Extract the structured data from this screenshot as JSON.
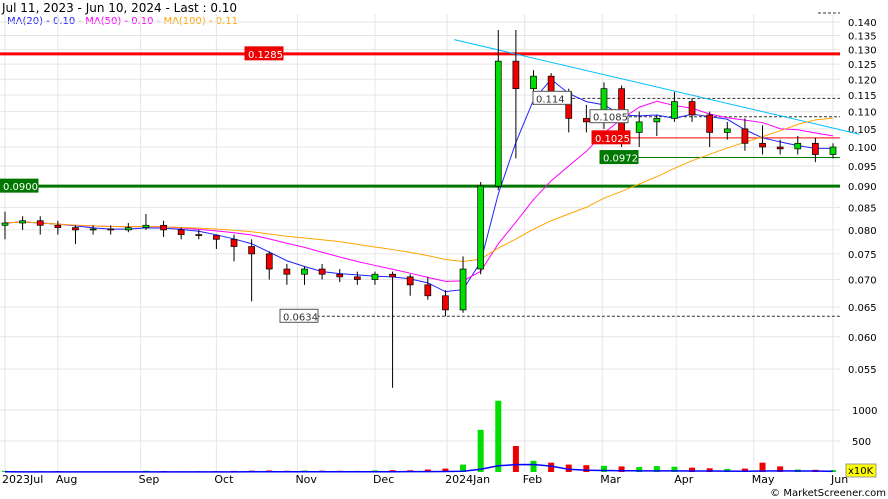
{
  "header": {
    "title": "Jul 11, 2023 - Jun 10, 2024 - Last : 0.10",
    "legend": [
      {
        "name": "MA(20)",
        "value": "0.10",
        "color": "#2020ff"
      },
      {
        "name": "MA(50)",
        "value": "0.10",
        "color": "#ff00ff"
      },
      {
        "name": "MA(100)",
        "value": "0.11",
        "color": "#ffa500"
      }
    ]
  },
  "chart_data": {
    "type": "candlestick",
    "title": "Jul 11, 2023 - Jun 10, 2024 - Last : 0.10",
    "y_ticks": [
      "0.140",
      "0.135",
      "0.130",
      "0.125",
      "0.120",
      "0.115",
      "0.110",
      "0.105",
      "0.100",
      "0.095",
      "0.090",
      "0.085",
      "0.080",
      "0.075",
      "0.070",
      "0.065",
      "0.060",
      "0.055"
    ],
    "ylim": [
      0.052,
      0.142
    ],
    "y_scale": "log",
    "volume_ticks": [
      "1000",
      "500"
    ],
    "volume_unit": "x10K",
    "months": [
      {
        "label": "2023Jul",
        "week": 0
      },
      {
        "label": "Aug",
        "week": 3
      },
      {
        "label": "Sep",
        "week": 7.7
      },
      {
        "label": "Oct",
        "week": 12
      },
      {
        "label": "Nov",
        "week": 16.6
      },
      {
        "label": "Dec",
        "week": 21
      },
      {
        "label": "2024Jan",
        "week": 25.1
      },
      {
        "label": "Feb",
        "week": 29.5
      },
      {
        "label": "Mar",
        "week": 33.9
      },
      {
        "label": "Apr",
        "week": 38.1
      },
      {
        "label": "May",
        "week": 42.5
      },
      {
        "label": "Jun",
        "week": 47
      }
    ],
    "candles": [
      [
        0.081,
        0.084,
        0.078,
        0.0815
      ],
      [
        0.0815,
        0.083,
        0.08,
        0.082
      ],
      [
        0.082,
        0.083,
        0.079,
        0.081
      ],
      [
        0.081,
        0.082,
        0.079,
        0.0805
      ],
      [
        0.0805,
        0.081,
        0.077,
        0.08
      ],
      [
        0.08,
        0.081,
        0.079,
        0.0802
      ],
      [
        0.0802,
        0.081,
        0.079,
        0.08
      ],
      [
        0.08,
        0.0815,
        0.0795,
        0.0805
      ],
      [
        0.0805,
        0.0835,
        0.08,
        0.081
      ],
      [
        0.081,
        0.082,
        0.0785,
        0.08
      ],
      [
        0.08,
        0.0805,
        0.078,
        0.079
      ],
      [
        0.079,
        0.08,
        0.078,
        0.0788
      ],
      [
        0.0788,
        0.079,
        0.076,
        0.078
      ],
      [
        0.078,
        0.079,
        0.0735,
        0.0765
      ],
      [
        0.0765,
        0.078,
        0.066,
        0.075
      ],
      [
        0.075,
        0.0755,
        0.07,
        0.072
      ],
      [
        0.072,
        0.073,
        0.069,
        0.071
      ],
      [
        0.071,
        0.0725,
        0.069,
        0.072
      ],
      [
        0.072,
        0.073,
        0.07,
        0.071
      ],
      [
        0.071,
        0.072,
        0.0695,
        0.0705
      ],
      [
        0.0705,
        0.0715,
        0.069,
        0.07
      ],
      [
        0.07,
        0.0715,
        0.069,
        0.071
      ],
      [
        0.071,
        0.0715,
        0.0523,
        0.0705
      ],
      [
        0.0705,
        0.071,
        0.067,
        0.069
      ],
      [
        0.069,
        0.0705,
        0.0663,
        0.067
      ],
      [
        0.067,
        0.068,
        0.0634,
        0.0645
      ],
      [
        0.0645,
        0.0745,
        0.064,
        0.072
      ],
      [
        0.072,
        0.091,
        0.071,
        0.09
      ],
      [
        0.09,
        0.137,
        0.089,
        0.126
      ],
      [
        0.126,
        0.137,
        0.097,
        0.117
      ],
      [
        0.117,
        0.123,
        0.112,
        0.121
      ],
      [
        0.121,
        0.122,
        0.113,
        0.116
      ],
      [
        0.116,
        0.117,
        0.104,
        0.108
      ],
      [
        0.108,
        0.112,
        0.104,
        0.107
      ],
      [
        0.107,
        0.119,
        0.105,
        0.117
      ],
      [
        0.117,
        0.118,
        0.1,
        0.104
      ],
      [
        0.104,
        0.11,
        0.1,
        0.107
      ],
      [
        0.107,
        0.109,
        0.103,
        0.108
      ],
      [
        0.108,
        0.116,
        0.107,
        0.113
      ],
      [
        0.113,
        0.114,
        0.107,
        0.109
      ],
      [
        0.109,
        0.11,
        0.1,
        0.104
      ],
      [
        0.104,
        0.107,
        0.102,
        0.105
      ],
      [
        0.105,
        0.108,
        0.099,
        0.101
      ],
      [
        0.101,
        0.106,
        0.098,
        0.1
      ],
      [
        0.1,
        0.102,
        0.098,
        0.0995
      ],
      [
        0.0995,
        0.103,
        0.098,
        0.101
      ],
      [
        0.101,
        0.1025,
        0.096,
        0.098
      ],
      [
        0.098,
        0.101,
        0.097,
        0.1
      ]
    ],
    "volume": [
      18,
      10,
      12,
      15,
      9,
      8,
      10,
      12,
      20,
      15,
      10,
      12,
      14,
      18,
      22,
      25,
      20,
      24,
      22,
      20,
      18,
      26,
      30,
      28,
      40,
      55,
      120,
      680,
      1150,
      420,
      180,
      150,
      120,
      110,
      100,
      90,
      80,
      95,
      85,
      70,
      60,
      50,
      55,
      150,
      90,
      40,
      35,
      30
    ],
    "moving_averages": [
      {
        "name": "MA(20)",
        "weeks": 4,
        "color": "#2020ff"
      },
      {
        "name": "MA(50)",
        "weeks": 10,
        "color": "#ff00ff"
      },
      {
        "name": "MA(100)",
        "weeks": 20,
        "color": "#ffa500"
      }
    ],
    "levels": [
      {
        "label": "0.1285",
        "value": 0.1285,
        "color": "#ff0000",
        "kind": "resistance-thick",
        "from_week": 0
      },
      {
        "label": "0.0900",
        "value": 0.09,
        "color": "#007700",
        "kind": "support-thick",
        "from_week": 0
      },
      {
        "label": "0.1025",
        "value": 0.1025,
        "color": "#ff0000",
        "kind": "thin",
        "from_week": 34
      },
      {
        "label": "0.0972",
        "value": 0.0972,
        "color": "#007700",
        "kind": "thin",
        "from_week": 34.5
      },
      {
        "label": "0.114",
        "value": 0.114,
        "color": "#333333",
        "kind": "dashed",
        "from_week": 30.5
      },
      {
        "label": "0.1085",
        "value": 0.1085,
        "color": "#333333",
        "kind": "dashed",
        "from_week": 34
      },
      {
        "label": "0.0634",
        "value": 0.0634,
        "color": "#333333",
        "kind": "dashed",
        "from_week": 16
      }
    ],
    "trendline": {
      "from": [
        25.5,
        0.1335
      ],
      "to": [
        48.5,
        0.1035
      ],
      "color": "#00bfff"
    },
    "colors": {
      "up": "#00dd00",
      "down": "#ee0000",
      "volume_ma": "#0000ff"
    }
  },
  "footer": {
    "copyright": "© MarketScreener.com",
    "volume_unit": "x10K"
  }
}
